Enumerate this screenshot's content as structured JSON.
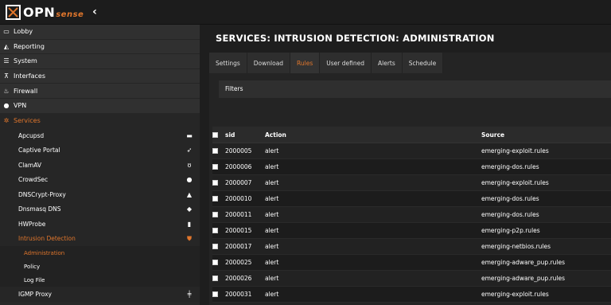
{
  "logo": {
    "brand": "OPN",
    "brand_suffix": "sense"
  },
  "sidebar": {
    "top_items": [
      {
        "label": "Lobby",
        "icon": "laptop-icon"
      },
      {
        "label": "Reporting",
        "icon": "area-chart-icon"
      },
      {
        "label": "System",
        "icon": "server-icon"
      },
      {
        "label": "Interfaces",
        "icon": "sitemap-icon"
      },
      {
        "label": "Firewall",
        "icon": "fire-icon"
      },
      {
        "label": "VPN",
        "icon": "globe-icon"
      },
      {
        "label": "Services",
        "icon": "gear-icon"
      }
    ],
    "service_items": [
      {
        "label": "Apcupsd",
        "icon": "battery-icon"
      },
      {
        "label": "Captive Portal",
        "icon": "paper-plane-icon"
      },
      {
        "label": "ClamAV",
        "icon": "stethoscope-icon"
      },
      {
        "label": "CrowdSec",
        "icon": "globe-icon"
      },
      {
        "label": "DNSCrypt-Proxy",
        "icon": "lock-icon"
      },
      {
        "label": "Dnsmasq DNS",
        "icon": "tag-icon"
      },
      {
        "label": "HWProbe",
        "icon": "thermometer-icon"
      },
      {
        "label": "Intrusion Detection",
        "icon": "shield-icon"
      }
    ],
    "ids_sub_items": [
      {
        "label": "Administration"
      },
      {
        "label": "Policy"
      },
      {
        "label": "Log File"
      }
    ],
    "after_items": [
      {
        "label": "IGMP Proxy",
        "icon": "signpost-icon"
      }
    ]
  },
  "page": {
    "title": "SERVICES: INTRUSION DETECTION: ADMINISTRATION"
  },
  "tabs": [
    {
      "label": "Settings"
    },
    {
      "label": "Download"
    },
    {
      "label": "Rules"
    },
    {
      "label": "User defined"
    },
    {
      "label": "Alerts"
    },
    {
      "label": "Schedule"
    }
  ],
  "filters": {
    "label": "Filters"
  },
  "grid": {
    "headers": {
      "sid": "sid",
      "action": "Action",
      "source": "Source"
    },
    "rows": [
      {
        "sid": "2000005",
        "action": "alert",
        "source": "emerging-exploit.rules"
      },
      {
        "sid": "2000006",
        "action": "alert",
        "source": "emerging-dos.rules"
      },
      {
        "sid": "2000007",
        "action": "alert",
        "source": "emerging-exploit.rules"
      },
      {
        "sid": "2000010",
        "action": "alert",
        "source": "emerging-dos.rules"
      },
      {
        "sid": "2000011",
        "action": "alert",
        "source": "emerging-dos.rules"
      },
      {
        "sid": "2000015",
        "action": "alert",
        "source": "emerging-p2p.rules"
      },
      {
        "sid": "2000017",
        "action": "alert",
        "source": "emerging-netbios.rules"
      },
      {
        "sid": "2000025",
        "action": "alert",
        "source": "emerging-adware_pup.rules"
      },
      {
        "sid": "2000026",
        "action": "alert",
        "source": "emerging-adware_pup.rules"
      },
      {
        "sid": "2000031",
        "action": "alert",
        "source": "emerging-exploit.rules"
      }
    ]
  },
  "colors": {
    "accent": "#e0762c",
    "sidebar_bg": "#282828",
    "main_bg": "#1e1e1e"
  }
}
